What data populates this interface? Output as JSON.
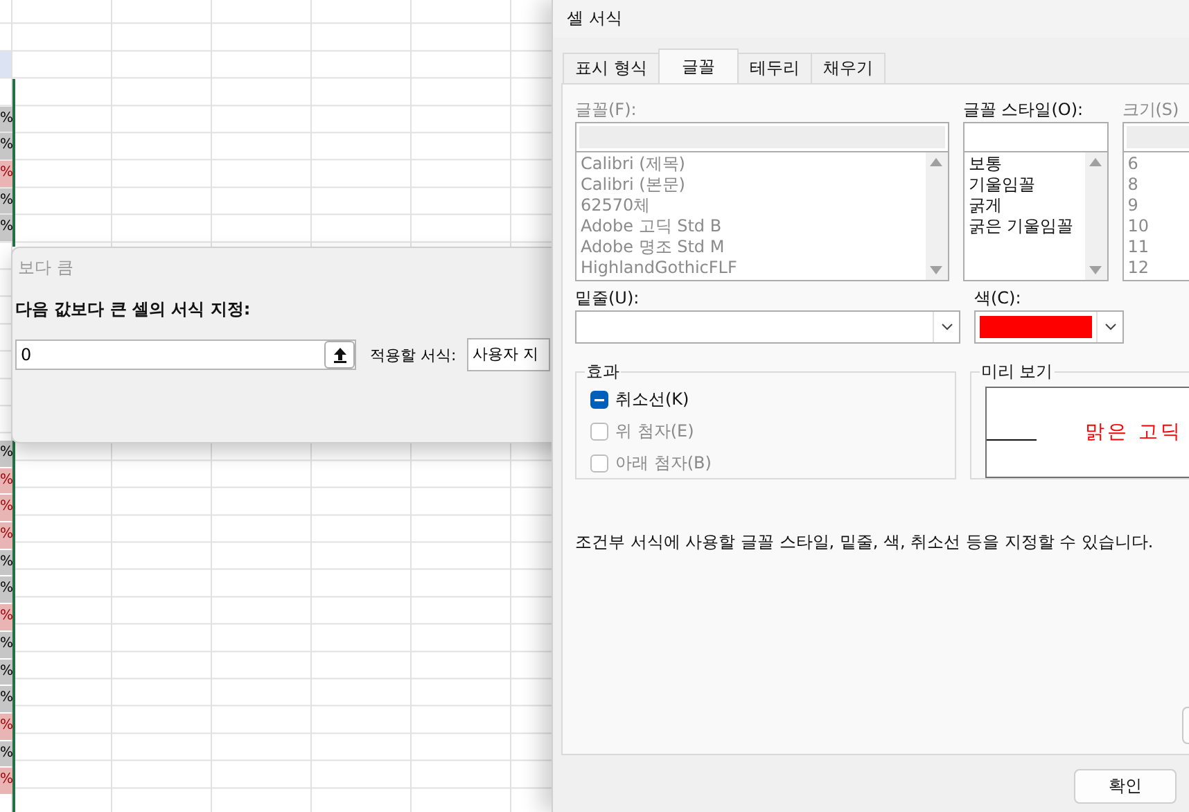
{
  "spreadsheet": {
    "cells_top": [
      {
        "text": "%",
        "kind": "neutral"
      },
      {
        "text": "%",
        "kind": "neutral"
      },
      {
        "text": "%",
        "kind": "bad"
      },
      {
        "text": "%",
        "kind": "neutral"
      },
      {
        "text": "%",
        "kind": "neutral"
      }
    ],
    "cells_bottom": [
      {
        "text": "%",
        "kind": "neutral"
      },
      {
        "text": "%",
        "kind": "bad"
      },
      {
        "text": "%",
        "kind": "bad"
      },
      {
        "text": "%",
        "kind": "bad"
      },
      {
        "text": "%",
        "kind": "neutral"
      },
      {
        "text": "%",
        "kind": "neutral"
      },
      {
        "text": "%",
        "kind": "bad"
      },
      {
        "text": "%",
        "kind": "neutral"
      },
      {
        "text": "%",
        "kind": "neutral"
      },
      {
        "text": "%",
        "kind": "neutral"
      },
      {
        "text": "%",
        "kind": "bad"
      },
      {
        "text": "%",
        "kind": "neutral"
      },
      {
        "text": "%",
        "kind": "bad"
      }
    ]
  },
  "greater_than_dialog": {
    "title": "보다 큼",
    "prompt": "다음 값보다 큰 셀의 서식 지정:",
    "value": "0",
    "format_label": "적용할 서식:",
    "format_value": "사용자 지"
  },
  "format_cells_dialog": {
    "title": "셀 서식",
    "tabs": [
      {
        "label": "표시 형식",
        "selected": false
      },
      {
        "label": "글꼴",
        "selected": true
      },
      {
        "label": "테두리",
        "selected": false
      },
      {
        "label": "채우기",
        "selected": false
      }
    ],
    "font": {
      "label": "글꼴(F):",
      "disabled": true,
      "items": [
        "Calibri (제목)",
        "Calibri (본문)",
        "62570체",
        "Adobe 고딕 Std B",
        "Adobe 명조 Std M",
        "HighlandGothicFLF"
      ]
    },
    "style": {
      "label": "글꼴 스타일(O):",
      "disabled": false,
      "items": [
        "보통",
        "기울임꼴",
        "굵게",
        "굵은 기울임꼴"
      ]
    },
    "size": {
      "label": "크기(S)",
      "disabled": true,
      "items": [
        "6",
        "8",
        "9",
        "10",
        "11",
        "12"
      ]
    },
    "underline": {
      "label": "밑줄(U):"
    },
    "color": {
      "label": "색(C):",
      "color": "#ff0000"
    },
    "effects": {
      "title": "효과",
      "options": [
        {
          "label": "취소선(K)",
          "indeterminate": true,
          "disabled": false
        },
        {
          "label": "위 첨자(E)",
          "indeterminate": false,
          "disabled": true
        },
        {
          "label": "아래 첨자(B)",
          "indeterminate": false,
          "disabled": true
        }
      ]
    },
    "preview": {
      "title": "미리 보기",
      "sample": "맑은 고딕"
    },
    "description": "조건부 서식에 사용할 글꼴 스타일, 밑줄, 색, 취소선 등을 지정할 수 있습니다.",
    "buttons": [
      "확인"
    ]
  }
}
